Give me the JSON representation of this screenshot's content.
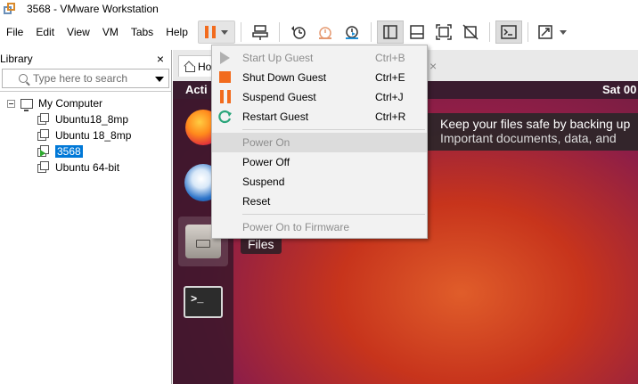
{
  "window": {
    "title": "3568 - VMware Workstation"
  },
  "menubar": {
    "items": [
      "File",
      "Edit",
      "View",
      "VM",
      "Tabs",
      "Help"
    ]
  },
  "library": {
    "title": "Library",
    "close_glyph": "×",
    "search_placeholder": "Type here to search",
    "root": "My Computer",
    "vms": [
      {
        "name": "Ubuntu18_8mp",
        "running": false
      },
      {
        "name": "Ubuntu 18_8mp",
        "running": false
      },
      {
        "name": "3568",
        "running": true,
        "selected": true
      },
      {
        "name": "Ubuntu 64-bit",
        "running": false
      }
    ]
  },
  "vm_tab": {
    "label": "Ho",
    "close_glyph": "×"
  },
  "guest": {
    "activities": "Acti",
    "clock": "Sat 00",
    "notification_line1": "Keep your files safe by backing up",
    "notification_line2": "Important documents, data, and",
    "files_tooltip": "Files",
    "terminal_prompt": ">_"
  },
  "power_menu": {
    "items": [
      {
        "label": "Start Up Guest",
        "shortcut": "Ctrl+B",
        "icon": "play-icon",
        "disabled": true
      },
      {
        "label": "Shut Down Guest",
        "shortcut": "Ctrl+E",
        "icon": "stop-icon",
        "disabled": false
      },
      {
        "label": "Suspend Guest",
        "shortcut": "Ctrl+J",
        "icon": "pause-icon",
        "disabled": false
      },
      {
        "label": "Restart Guest",
        "shortcut": "Ctrl+R",
        "icon": "restart-icon",
        "disabled": false
      },
      {
        "label": "Power On",
        "shortcut": "",
        "icon": "",
        "disabled": true,
        "hovered": true
      },
      {
        "label": "Power Off",
        "shortcut": "",
        "icon": "",
        "disabled": false
      },
      {
        "label": "Suspend",
        "shortcut": "",
        "icon": "",
        "disabled": false
      },
      {
        "label": "Reset",
        "shortcut": "",
        "icon": "",
        "disabled": false
      },
      {
        "label": "Power On to Firmware",
        "shortcut": "",
        "icon": "",
        "disabled": true
      }
    ]
  },
  "colors": {
    "accent_orange": "#f26b1d",
    "restart_green": "#2aa57a",
    "selection_blue": "#0078d7"
  }
}
